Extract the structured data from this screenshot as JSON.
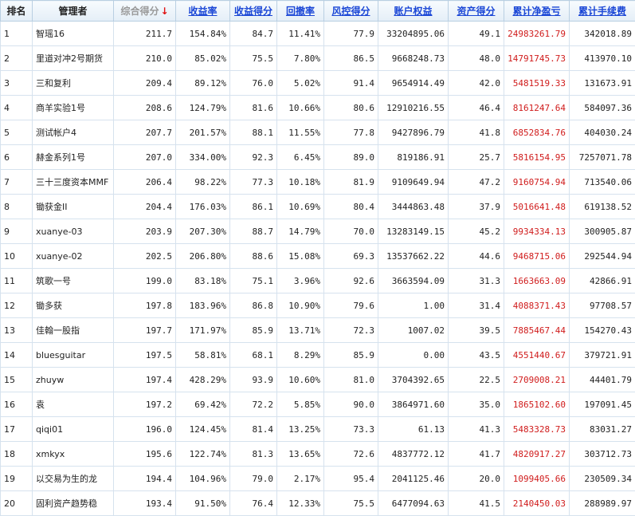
{
  "headers": {
    "rank": "排名",
    "manager": "管理者",
    "total_score": "综合得分",
    "sort_arrow": "↓",
    "return_rate": "收益率",
    "return_score": "收益得分",
    "drawdown": "回撤率",
    "risk_score": "风控得分",
    "equity": "账户权益",
    "asset_score": "资产得分",
    "net_profit": "累计净盈亏",
    "fees": "累计手续费"
  },
  "colors": {
    "link": "#1a46d6",
    "sorted_header": "#999999",
    "sort_arrow": "#e01010",
    "profit": "#d01c1c"
  },
  "rows": [
    {
      "rank": "1",
      "manager": "智瑶16",
      "total_score": "211.7",
      "return_rate": "154.84%",
      "return_score": "84.7",
      "drawdown": "11.41%",
      "risk_score": "77.9",
      "equity": "33204895.06",
      "asset_score": "49.1",
      "net_profit": "24983261.79",
      "fees": "342018.89"
    },
    {
      "rank": "2",
      "manager": "里道对冲2号期货",
      "total_score": "210.0",
      "return_rate": "85.02%",
      "return_score": "75.5",
      "drawdown": "7.80%",
      "risk_score": "86.5",
      "equity": "9668248.73",
      "asset_score": "48.0",
      "net_profit": "14791745.73",
      "fees": "413970.10"
    },
    {
      "rank": "3",
      "manager": "三和复利",
      "total_score": "209.4",
      "return_rate": "89.12%",
      "return_score": "76.0",
      "drawdown": "5.02%",
      "risk_score": "91.4",
      "equity": "9654914.49",
      "asset_score": "42.0",
      "net_profit": "5481519.33",
      "fees": "131673.91"
    },
    {
      "rank": "4",
      "manager": "商羊实验1号",
      "total_score": "208.6",
      "return_rate": "124.79%",
      "return_score": "81.6",
      "drawdown": "10.66%",
      "risk_score": "80.6",
      "equity": "12910216.55",
      "asset_score": "46.4",
      "net_profit": "8161247.64",
      "fees": "584097.36"
    },
    {
      "rank": "5",
      "manager": "测试帐户4",
      "total_score": "207.7",
      "return_rate": "201.57%",
      "return_score": "88.1",
      "drawdown": "11.55%",
      "risk_score": "77.8",
      "equity": "9427896.79",
      "asset_score": "41.8",
      "net_profit": "6852834.76",
      "fees": "404030.24"
    },
    {
      "rank": "6",
      "manager": "赫金系列1号",
      "total_score": "207.0",
      "return_rate": "334.00%",
      "return_score": "92.3",
      "drawdown": "6.45%",
      "risk_score": "89.0",
      "equity": "819186.91",
      "asset_score": "25.7",
      "net_profit": "5816154.95",
      "fees": "7257071.78"
    },
    {
      "rank": "7",
      "manager": "三十三度资本MMF",
      "total_score": "206.4",
      "return_rate": "98.22%",
      "return_score": "77.3",
      "drawdown": "10.18%",
      "risk_score": "81.9",
      "equity": "9109649.94",
      "asset_score": "47.2",
      "net_profit": "9160754.94",
      "fees": "713540.06"
    },
    {
      "rank": "8",
      "manager": "锄获金II",
      "total_score": "204.4",
      "return_rate": "176.03%",
      "return_score": "86.1",
      "drawdown": "10.69%",
      "risk_score": "80.4",
      "equity": "3444863.48",
      "asset_score": "37.9",
      "net_profit": "5016641.48",
      "fees": "619138.52"
    },
    {
      "rank": "9",
      "manager": "xuanye-03",
      "total_score": "203.9",
      "return_rate": "207.30%",
      "return_score": "88.7",
      "drawdown": "14.79%",
      "risk_score": "70.0",
      "equity": "13283149.15",
      "asset_score": "45.2",
      "net_profit": "9934334.13",
      "fees": "300905.87"
    },
    {
      "rank": "10",
      "manager": "xuanye-02",
      "total_score": "202.5",
      "return_rate": "206.80%",
      "return_score": "88.6",
      "drawdown": "15.08%",
      "risk_score": "69.3",
      "equity": "13537662.22",
      "asset_score": "44.6",
      "net_profit": "9468715.06",
      "fees": "292544.94"
    },
    {
      "rank": "11",
      "manager": "筑歌一号",
      "total_score": "199.0",
      "return_rate": "83.18%",
      "return_score": "75.1",
      "drawdown": "3.96%",
      "risk_score": "92.6",
      "equity": "3663594.09",
      "asset_score": "31.3",
      "net_profit": "1663663.09",
      "fees": "42866.91"
    },
    {
      "rank": "12",
      "manager": "锄多获",
      "total_score": "197.8",
      "return_rate": "183.96%",
      "return_score": "86.8",
      "drawdown": "10.90%",
      "risk_score": "79.6",
      "equity": "1.00",
      "asset_score": "31.4",
      "net_profit": "4088371.43",
      "fees": "97708.57"
    },
    {
      "rank": "13",
      "manager": "佳翰一股指",
      "total_score": "197.7",
      "return_rate": "171.97%",
      "return_score": "85.9",
      "drawdown": "13.71%",
      "risk_score": "72.3",
      "equity": "1007.02",
      "asset_score": "39.5",
      "net_profit": "7885467.44",
      "fees": "154270.43"
    },
    {
      "rank": "14",
      "manager": "bluesguitar",
      "total_score": "197.5",
      "return_rate": "58.81%",
      "return_score": "68.1",
      "drawdown": "8.29%",
      "risk_score": "85.9",
      "equity": "0.00",
      "asset_score": "43.5",
      "net_profit": "4551440.67",
      "fees": "379721.91"
    },
    {
      "rank": "15",
      "manager": "zhuyw",
      "total_score": "197.4",
      "return_rate": "428.29%",
      "return_score": "93.9",
      "drawdown": "10.60%",
      "risk_score": "81.0",
      "equity": "3704392.65",
      "asset_score": "22.5",
      "net_profit": "2709008.21",
      "fees": "44401.79"
    },
    {
      "rank": "16",
      "manager": "袁",
      "total_score": "197.2",
      "return_rate": "69.42%",
      "return_score": "72.2",
      "drawdown": "5.85%",
      "risk_score": "90.0",
      "equity": "3864971.60",
      "asset_score": "35.0",
      "net_profit": "1865102.60",
      "fees": "197091.45"
    },
    {
      "rank": "17",
      "manager": "qiqi01",
      "total_score": "196.0",
      "return_rate": "124.45%",
      "return_score": "81.4",
      "drawdown": "13.25%",
      "risk_score": "73.3",
      "equity": "61.13",
      "asset_score": "41.3",
      "net_profit": "5483328.73",
      "fees": "83031.27"
    },
    {
      "rank": "18",
      "manager": "xmkyx",
      "total_score": "195.6",
      "return_rate": "122.74%",
      "return_score": "81.3",
      "drawdown": "13.65%",
      "risk_score": "72.6",
      "equity": "4837772.12",
      "asset_score": "41.7",
      "net_profit": "4820917.27",
      "fees": "303712.73"
    },
    {
      "rank": "19",
      "manager": "以交易为生的龙",
      "total_score": "194.4",
      "return_rate": "104.96%",
      "return_score": "79.0",
      "drawdown": "2.17%",
      "risk_score": "95.4",
      "equity": "2041125.46",
      "asset_score": "20.0",
      "net_profit": "1099405.66",
      "fees": "230509.34"
    },
    {
      "rank": "20",
      "manager": "固利资产趋势稳",
      "total_score": "193.4",
      "return_rate": "91.50%",
      "return_score": "76.4",
      "drawdown": "12.33%",
      "risk_score": "75.5",
      "equity": "6477094.63",
      "asset_score": "41.5",
      "net_profit": "2140450.03",
      "fees": "288989.97"
    }
  ]
}
